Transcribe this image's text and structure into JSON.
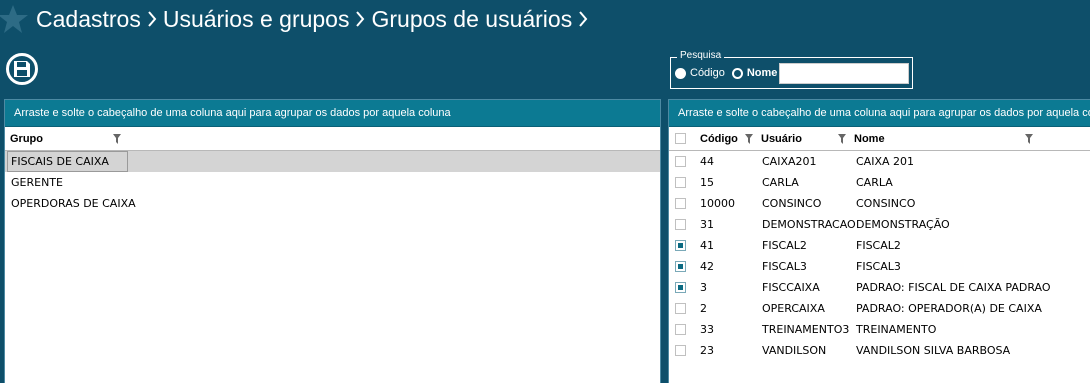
{
  "breadcrumb": {
    "items": [
      "Cadastros",
      "Usuários e grupos",
      "Grupos de usuários"
    ]
  },
  "icons": {
    "favorite": "star-icon",
    "save": "floppy-disk-icon",
    "filter": "filter-funnel-icon",
    "separator": "chevron-right-icon"
  },
  "colors": {
    "background": "#0e4f6a",
    "group_bar": "#0c7a93",
    "checkbox_fill": "#0b6a82",
    "selected_row": "#d4d4d4"
  },
  "search": {
    "legend": "Pesquisa",
    "options": [
      {
        "label": "Código",
        "checked": false
      },
      {
        "label": "Nome",
        "checked": true
      }
    ],
    "value": ""
  },
  "left_panel": {
    "group_bar": "Arraste e solte o cabeçalho de uma coluna aqui para agrupar os dados por aquela coluna",
    "column": "Grupo",
    "rows": [
      {
        "name": "FISCAIS DE CAIXA",
        "selected": true
      },
      {
        "name": "GERENTE",
        "selected": false
      },
      {
        "name": "OPERDORAS DE CAIXA",
        "selected": false
      }
    ]
  },
  "right_panel": {
    "group_bar": "Arraste e solte o cabeçalho de uma coluna aqui para agrupar os dados por aquela coluna",
    "columns": {
      "code": "Código",
      "user": "Usuário",
      "name": "Nome"
    },
    "rows": [
      {
        "checked": false,
        "code": "44",
        "user": "CAIXA201",
        "name": "CAIXA 201"
      },
      {
        "checked": false,
        "code": "15",
        "user": "CARLA",
        "name": "CARLA"
      },
      {
        "checked": false,
        "code": "10000",
        "user": "CONSINCO",
        "name": "CONSINCO"
      },
      {
        "checked": false,
        "code": "31",
        "user": "DEMONSTRACAO",
        "name": "DEMONSTRAÇÃO"
      },
      {
        "checked": true,
        "code": "41",
        "user": "FISCAL2",
        "name": "FISCAL2"
      },
      {
        "checked": true,
        "code": "42",
        "user": "FISCAL3",
        "name": "FISCAL3"
      },
      {
        "checked": true,
        "code": "3",
        "user": "FISCCAIXA",
        "name": "PADRAO: FISCAL DE CAIXA PADRAO"
      },
      {
        "checked": false,
        "code": "2",
        "user": "OPERCAIXA",
        "name": "PADRAO: OPERADOR(A) DE CAIXA"
      },
      {
        "checked": false,
        "code": "33",
        "user": "TREINAMENTO3",
        "name": "TREINAMENTO"
      },
      {
        "checked": false,
        "code": "23",
        "user": "VANDILSON",
        "name": "VANDILSON SILVA BARBOSA"
      }
    ]
  }
}
